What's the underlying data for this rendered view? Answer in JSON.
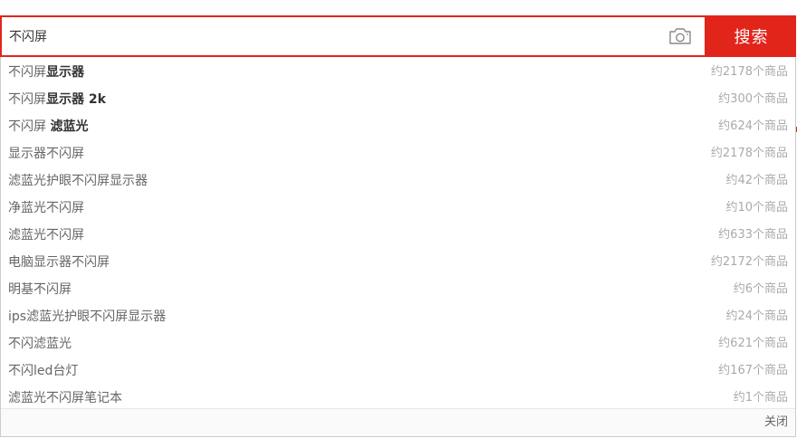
{
  "search": {
    "value": "不闪屏",
    "button_label": "搜索",
    "camera_icon": "camera-icon"
  },
  "suggestions": [
    {
      "prefix": "不闪屏",
      "bold": "显示器",
      "count": "约2178个商品"
    },
    {
      "prefix": "不闪屏",
      "bold": "显示器 2k",
      "count": "约300个商品"
    },
    {
      "prefix": "不闪屏 ",
      "bold": "滤蓝光",
      "count": "约624个商品"
    },
    {
      "prefix": "显示器不闪屏",
      "bold": "",
      "count": "约2178个商品"
    },
    {
      "prefix": "滤蓝光护眼不闪屏显示器",
      "bold": "",
      "count": "约42个商品"
    },
    {
      "prefix": "净蓝光不闪屏",
      "bold": "",
      "count": "约10个商品"
    },
    {
      "prefix": "滤蓝光不闪屏",
      "bold": "",
      "count": "约633个商品"
    },
    {
      "prefix": "电脑显示器不闪屏",
      "bold": "",
      "count": "约2172个商品"
    },
    {
      "prefix": "明基不闪屏",
      "bold": "",
      "count": "约6个商品"
    },
    {
      "prefix": "ips滤蓝光护眼不闪屏显示器",
      "bold": "",
      "count": "约24个商品"
    },
    {
      "prefix": "不闪滤蓝光",
      "bold": "",
      "count": "约621个商品"
    },
    {
      "prefix": "不闪led台灯",
      "bold": "",
      "count": "约167个商品"
    },
    {
      "prefix": "滤蓝光不闪屏笔记本",
      "bold": "",
      "count": "约1个商品"
    }
  ],
  "footer": {
    "close_label": "关闭"
  },
  "colors": {
    "accent": "#e1251b",
    "text": "#666666",
    "count_text": "#aaaaaa"
  }
}
